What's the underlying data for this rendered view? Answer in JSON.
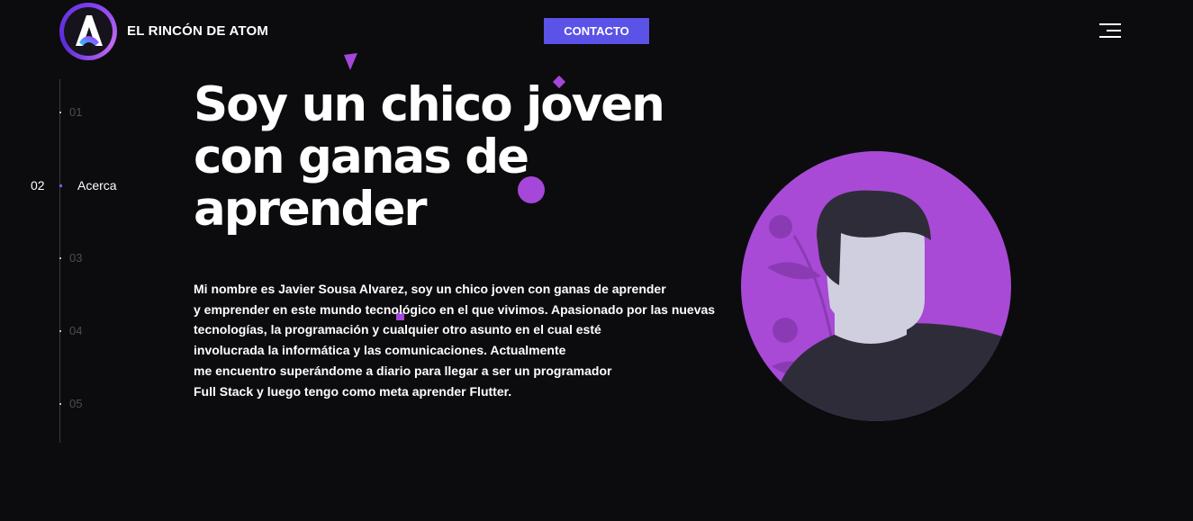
{
  "header": {
    "brand": "EL RINCÓN DE ATOM",
    "contact_label": "CONTACTO",
    "logo_letter": "A"
  },
  "side_nav": {
    "items": [
      {
        "num": "01"
      },
      {
        "num": "02",
        "label": "Acerca",
        "active": true
      },
      {
        "num": "03"
      },
      {
        "num": "04"
      },
      {
        "num": "05"
      }
    ]
  },
  "hero": {
    "title_lines": [
      "Soy un chico joven",
      "con ganas de",
      "aprender"
    ],
    "bio_lines": [
      "Mi nombre es Javier Sousa Alvarez, soy un chico joven con ganas de aprender",
      "y emprender en este mundo tecnológico en el que vivimos. Apasionado por las nuevas",
      "tecnologías, la programación y cualquier otro asunto en el cual esté",
      "involucrada la informática y las comunicaciones. Actualmente",
      "me encuentro superándome a diario para llegar a ser un programador",
      "Full Stack y luego tengo como meta aprender Flutter."
    ]
  },
  "colors": {
    "background": "#0c0b0d",
    "accent_purple": "#a547d8",
    "button_blue": "#5b52e8",
    "avatar_circle": "#a84ad6",
    "hair": "#2f2c3a",
    "skin": "#d0cfe0"
  },
  "icons": {
    "logo": "atom-logo-icon",
    "menu": "hamburger-menu-icon"
  }
}
